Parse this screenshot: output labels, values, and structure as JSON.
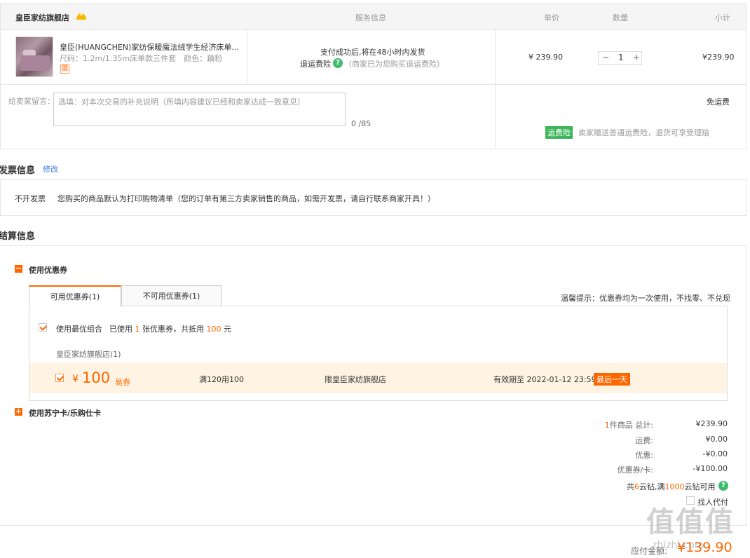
{
  "order": {
    "store_name": "皇臣家纺旗舰店",
    "headers": {
      "service": "服务信息",
      "price": "单价",
      "qty": "数量",
      "subtotal": "小计"
    },
    "item": {
      "title": "皇臣(HUANGCHEN)家纺保暖魔法绒学生经济床单...",
      "spec": "尺码：1.2m/1.35m床单款三件套　颜色：藕粉",
      "tag": "圜",
      "service_line1": "支付成功后,将在48小时内发货",
      "service_return": "退运费险",
      "service_return_note": "（商家已为您购买退运费险）",
      "price": "¥ 239.90",
      "qty": "1",
      "qty_minus": "−",
      "qty_plus": "+",
      "subtotal": "¥239.90"
    },
    "message": {
      "label": "给卖家留言：",
      "placeholder": "选填：对本次交易的补充说明（所填内容建议已经和卖家达成一致意见）",
      "counter": "0 /85"
    },
    "shipping": {
      "free": "免运费",
      "insurance_tag": "运费险",
      "insurance_text": "卖家赠送普通运费险，退货可享受理赔"
    }
  },
  "invoice": {
    "title": "发票信息",
    "edit": "修改",
    "type": "不开发票",
    "note": "您购买的商品默认为打印购物清单（您的订单有第三方卖家销售的商品，如需开发票，请自行联系商家开具！）"
  },
  "settlement": {
    "title": "结算信息",
    "coupon_section": "使用优惠券",
    "tabs": [
      "可用优惠券(1)",
      "不可用优惠券(1)"
    ],
    "tip": "温馨提示：优惠券均为一次使用，不找零、不兑现",
    "best_combo": "使用最优组合",
    "used_prefix": "已使用",
    "used_count": "1",
    "used_mid": "张优惠券，共抵用",
    "used_amount": "100",
    "used_suffix": "元",
    "store_group": "皇臣家纺旗舰店(1)",
    "coupon": {
      "currency": "¥",
      "amount": "100",
      "kind": "易券",
      "condition": "满120用100",
      "scope": "限皇臣家纺旗舰店",
      "expiry": "有效期至 2022-01-12 23:59",
      "badge": "最后一天"
    },
    "card_section": "使用苏宁卡/乐购仕卡"
  },
  "summary": {
    "items_count": "1",
    "items_label": "件商品 总计:",
    "items_total": "¥239.90",
    "shipping_label": "运费:",
    "shipping_val": "¥0.00",
    "discount_label": "优惠:",
    "discount_val": "-¥0.00",
    "coupon_label": "优惠券/卡:",
    "coupon_val": "-¥100.00",
    "yunzuan_pre": "共",
    "yunzuan_count": "6",
    "yunzuan_mid": "云钻,满",
    "yunzuan_threshold": "1000",
    "yunzuan_suf": "云钻可用",
    "find_pay": "找人代付",
    "payable_label": "应付金额:",
    "payable": "¥139.90"
  },
  "watermark": {
    "text": "值值值",
    "url": "zhizhi.com"
  },
  "colors": {
    "accent": "#ff6600",
    "green": "#3cb559"
  }
}
